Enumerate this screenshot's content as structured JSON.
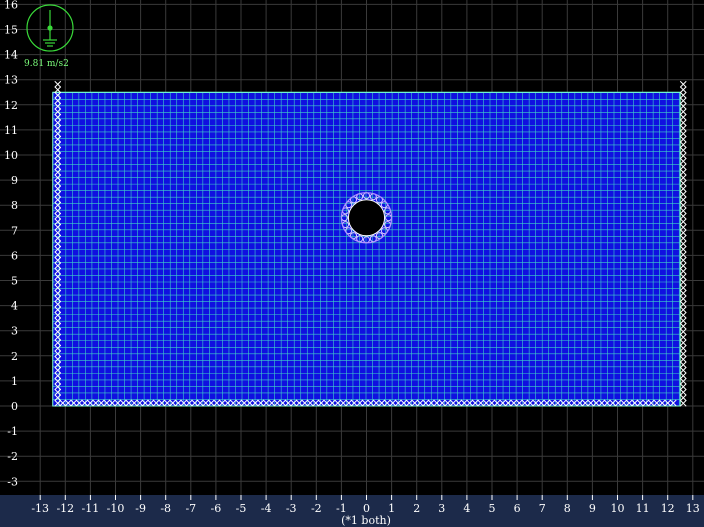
{
  "window": {
    "background_color": "#1c2a4a",
    "canvas_color": "#000000",
    "grid_color": "#3a3a3a"
  },
  "axes": {
    "x_ticks": [
      "-13",
      "-12",
      "-11",
      "-10",
      "-9",
      "-8",
      "-7",
      "-6",
      "-5",
      "-4",
      "-3",
      "-2",
      "-1",
      "0",
      "1",
      "2",
      "3",
      "4",
      "5",
      "6",
      "7",
      "8",
      "9",
      "10",
      "11",
      "12",
      "13"
    ],
    "y_ticks": [
      "16",
      "15",
      "14",
      "13",
      "12",
      "11",
      "10",
      "9",
      "8",
      "7",
      "6",
      "5",
      "4",
      "3",
      "2",
      "1",
      "0",
      "-1",
      "-2",
      "-3"
    ],
    "units_label": "(*1 both)"
  },
  "gravity": {
    "value_label": "9.81 m/s2",
    "color": "#39d939",
    "icon": "gravity-arrow-icon"
  },
  "model": {
    "soil_color": "#1010e0",
    "mesh_color": "#3fd1c8",
    "boundary_color": "#ffffff",
    "tunnel_color": "#000000",
    "x_range": [
      -12.5,
      12.5
    ],
    "y_range": [
      0,
      12.5
    ],
    "tunnel_center": [
      0,
      7.5
    ],
    "tunnel_radius": 0.6
  }
}
